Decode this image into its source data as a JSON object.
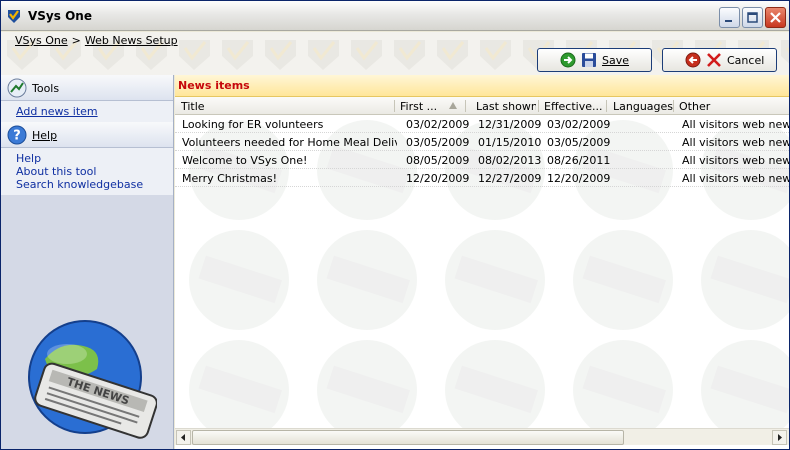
{
  "window": {
    "title": "VSys One"
  },
  "breadcrumb": {
    "home": "VSys One",
    "separator": ">",
    "current": "Web News Setup"
  },
  "toolbar": {
    "save_label": "Save",
    "cancel_label": "Cancel"
  },
  "sidebar": {
    "tools": {
      "label": "Tools",
      "links": [
        "Add news item"
      ]
    },
    "help": {
      "label": "Help",
      "links": [
        "Help",
        "About this tool",
        "Search knowledgebase"
      ]
    }
  },
  "news": {
    "section_title": "News items",
    "columns": [
      "Title",
      "First ...",
      "Last shown",
      "Effective...",
      "Languages",
      "Other"
    ],
    "rows": [
      [
        "Looking for ER volunteers",
        "03/02/2009",
        "12/31/2009",
        "03/02/2009",
        "",
        "All visitors web news"
      ],
      [
        "Volunteers needed for Home Meal Delivery",
        "03/05/2009",
        "01/15/2010",
        "03/05/2009",
        "",
        "All visitors web news"
      ],
      [
        "Welcome to VSys One!",
        "08/05/2009",
        "08/02/2013",
        "08/26/2011",
        "",
        "All visitors web news"
      ],
      [
        "Merry Christmas!",
        "12/20/2009",
        "12/27/2009",
        "12/20/2009",
        "",
        "All visitors web news"
      ]
    ]
  },
  "icons": {
    "app": "vsys-shield-icon",
    "tools": "tools-icon",
    "help": "question-circle-icon",
    "save_arrow": "green-arrow-icon",
    "save_disk": "floppy-disk-icon",
    "cancel_arrow": "red-back-arrow-icon",
    "cancel_x": "red-x-icon",
    "sort": "sort-ascending-icon"
  },
  "colors": {
    "section_title": "#c6070b",
    "link": "#0f2fa1",
    "section_band": "#ffe69a"
  }
}
